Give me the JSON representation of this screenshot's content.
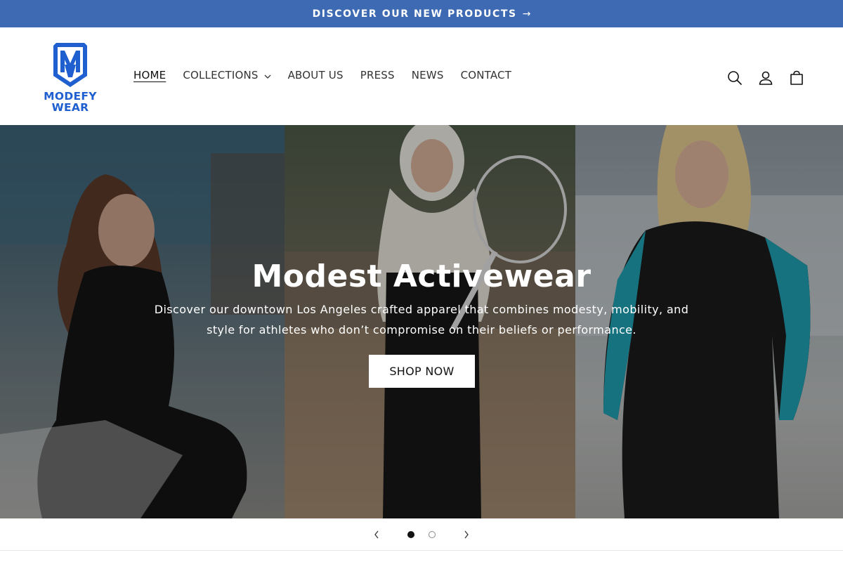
{
  "announcement": {
    "text": "DISCOVER OUR NEW PRODUCTS",
    "arrow": "→"
  },
  "brand": {
    "line1": "MODEFY",
    "line2": "WEAR",
    "color": "#1f5fd0"
  },
  "nav": {
    "items": [
      {
        "label": "HOME",
        "active": true
      },
      {
        "label": "COLLECTIONS",
        "has_dropdown": true
      },
      {
        "label": "ABOUT US"
      },
      {
        "label": "PRESS"
      },
      {
        "label": "NEWS"
      },
      {
        "label": "CONTACT"
      }
    ]
  },
  "header_icons": [
    "search-icon",
    "account-icon",
    "cart-icon"
  ],
  "hero": {
    "title": "Modest Activewear",
    "subtitle": "Discover our downtown Los Angeles crafted apparel that combines modesty, mobility, and style for athletes who don’t compromise on their beliefs or performance.",
    "cta": "SHOP NOW"
  },
  "slider": {
    "current": 1,
    "total": 2
  },
  "colors": {
    "announcement_bg": "#3d6ab3",
    "text": "#121212"
  }
}
